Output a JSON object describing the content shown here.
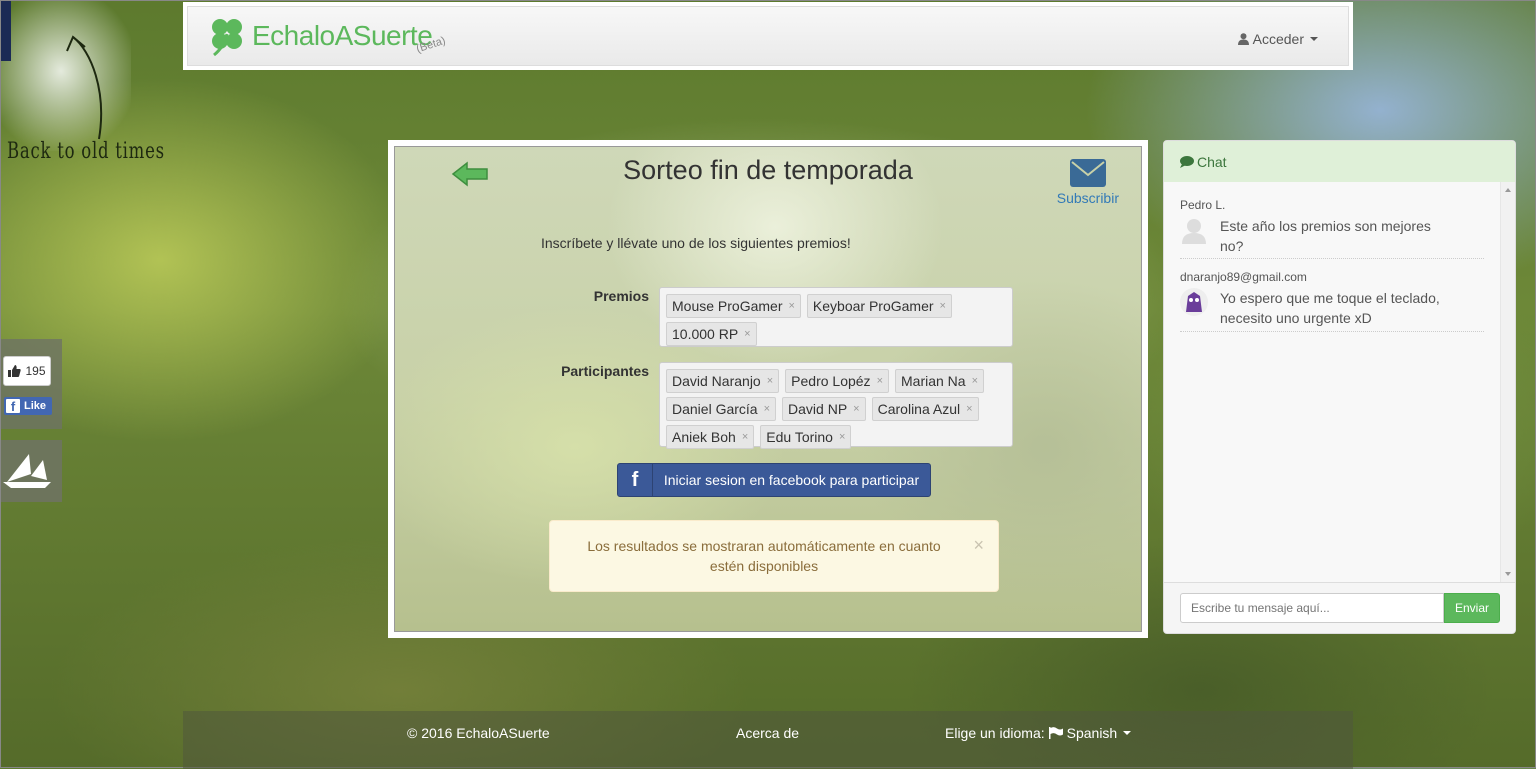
{
  "corner": {
    "label": "Back to old times"
  },
  "navbar": {
    "brand": "EchaloASuerte",
    "beta": "(Beta)",
    "login_label": "Acceder",
    "brand_color": "#5cb85c"
  },
  "social": {
    "like_count": "195",
    "like_label": "Like"
  },
  "main": {
    "title": "Sorteo fin de temporada",
    "subscribe_label": "Subscribir",
    "intro": "Inscríbete y llévate uno de los siguientes premios!",
    "prizes_label": "Premios",
    "prizes": [
      "Mouse ProGamer",
      "Keyboar ProGamer",
      "10.000 RP"
    ],
    "participants_label": "Participantes",
    "participants": [
      "David Naranjo",
      "Pedro Lopéz",
      "Marian Na",
      "Daniel García",
      "David NP",
      "Carolina Azul",
      "Aniek Boh",
      "Edu Torino"
    ],
    "facebook_button": "Iniciar sesion en facebook para participar",
    "alert_text": "Los resultados se mostraran automáticamente en cuanto estén disponibles",
    "alert_close": "×",
    "tag_remove": "×"
  },
  "chat": {
    "title": "Chat",
    "messages": [
      {
        "user": "Pedro L.",
        "text": "Este año los premios son mejores no?"
      },
      {
        "user": "dnaranjo89@gmail.com",
        "text": "Yo espero que me toque el teclado, necesito uno urgente xD"
      }
    ],
    "input_placeholder": "Escribe tu mensaje aquí...",
    "send_label": "Enviar",
    "header_color": "#dff0d8"
  },
  "footer": {
    "copyright": "© 2016 EchaloASuerte",
    "about": "Acerca de",
    "language_prompt": "Elige un idioma:",
    "language": "Spanish"
  }
}
